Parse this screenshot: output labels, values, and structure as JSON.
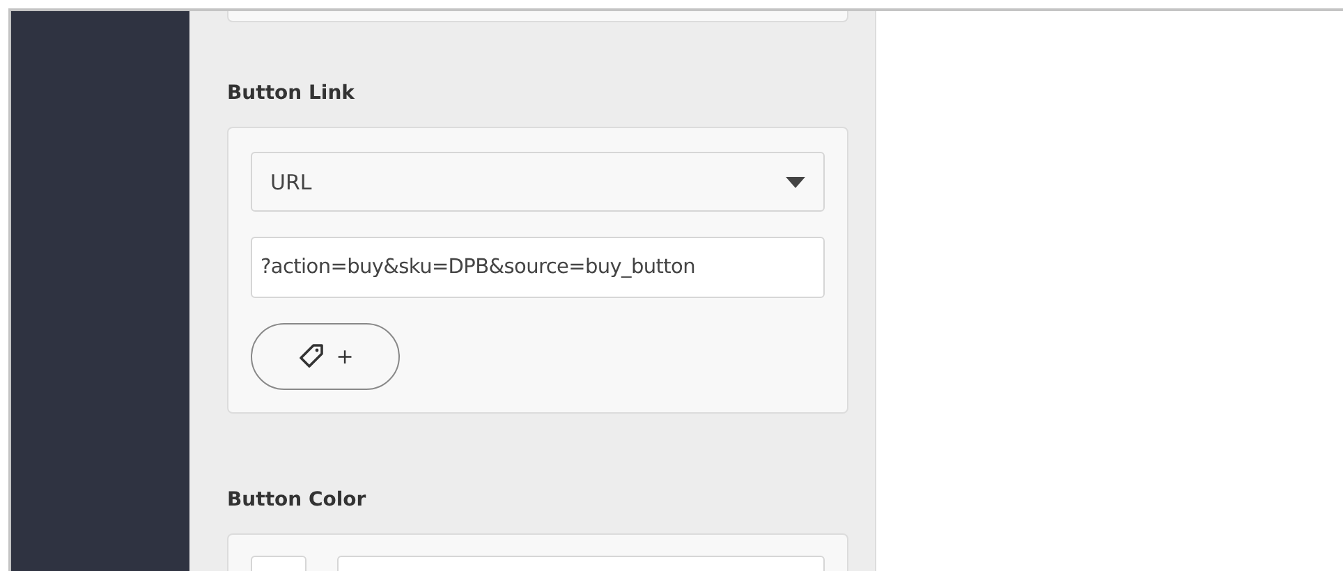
{
  "button_link": {
    "title": "Button Link",
    "link_type": "URL",
    "url_value": "?action=buy&sku=DPB&source=buy_button",
    "tag_button_label": "+"
  },
  "button_color": {
    "title": "Button Color"
  }
}
